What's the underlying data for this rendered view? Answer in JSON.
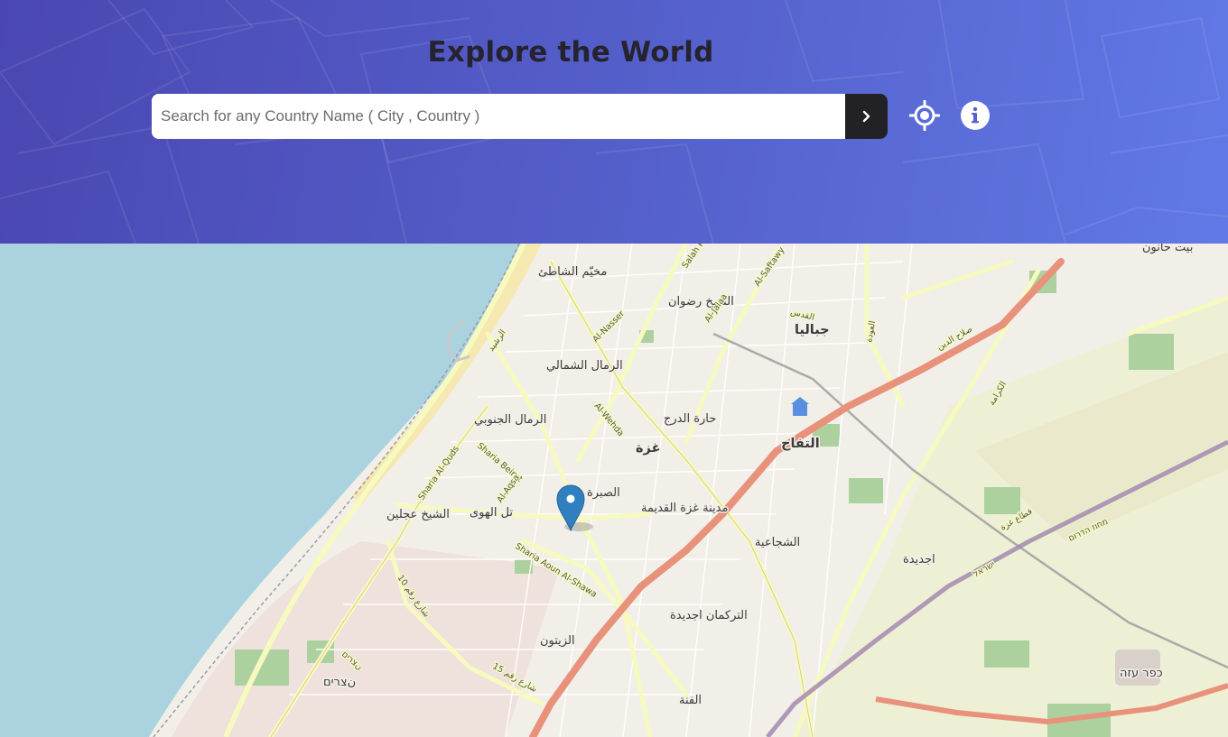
{
  "header": {
    "title": "Explore the World",
    "search": {
      "placeholder": "Search for any Country Name ( City , Country )",
      "value": ""
    },
    "search_button_icon": "chevron-right-icon",
    "locate_button_icon": "crosshair-locate-icon",
    "info_button_icon": "info-circle-icon",
    "colors": {
      "gradient_start": "#4a47b2",
      "gradient_end": "#6179e6",
      "title": "#25232e",
      "search_button": "#222226"
    }
  },
  "map": {
    "marker_icon": "map-pin-marker-icon",
    "marker_color": "#2f7fc1",
    "place_labels": [
      "مخيّم الشاطئ",
      "الشيخ رضوان",
      "جباليا",
      "الرمال الشمالي",
      "الرمال الجنوبي",
      "حارة الدرج",
      "غزة",
      "التفاح",
      "الصبرة",
      "مدينة غزة القديمة",
      "تل الهوى",
      "الشيخ عجلين",
      "الشجاعية",
      "اجديدة",
      "التركمان اجديدة",
      "الزيتون",
      "نצרים",
      "כפר עזה",
      "الفنة",
      "بيت حانون"
    ],
    "road_labels": [
      "Al-Nasser",
      "Al-Jalaa",
      "Al-Wehda",
      "Sharia Beirut",
      "Sharia Al-Quds",
      "Al-Aqsa",
      "Sharia Aoun Al-Shawa",
      "Salah Khalaf",
      "Al-Saftawy",
      "صلاح الدين",
      "شارع رقم 10",
      "الرشيد",
      "الكرامة",
      "شارع رقم 15",
      "نצרים",
      "ישראל",
      "מחוז הדרום",
      "قطاع غزة",
      "القدس",
      "العودة"
    ],
    "colors": {
      "sea": "#aad3df",
      "land": "#f2efe9",
      "major_road": "#e8927c",
      "secondary_road": "#f7fabf",
      "park": "#add19e",
      "farmland": "#eef0d5"
    }
  }
}
